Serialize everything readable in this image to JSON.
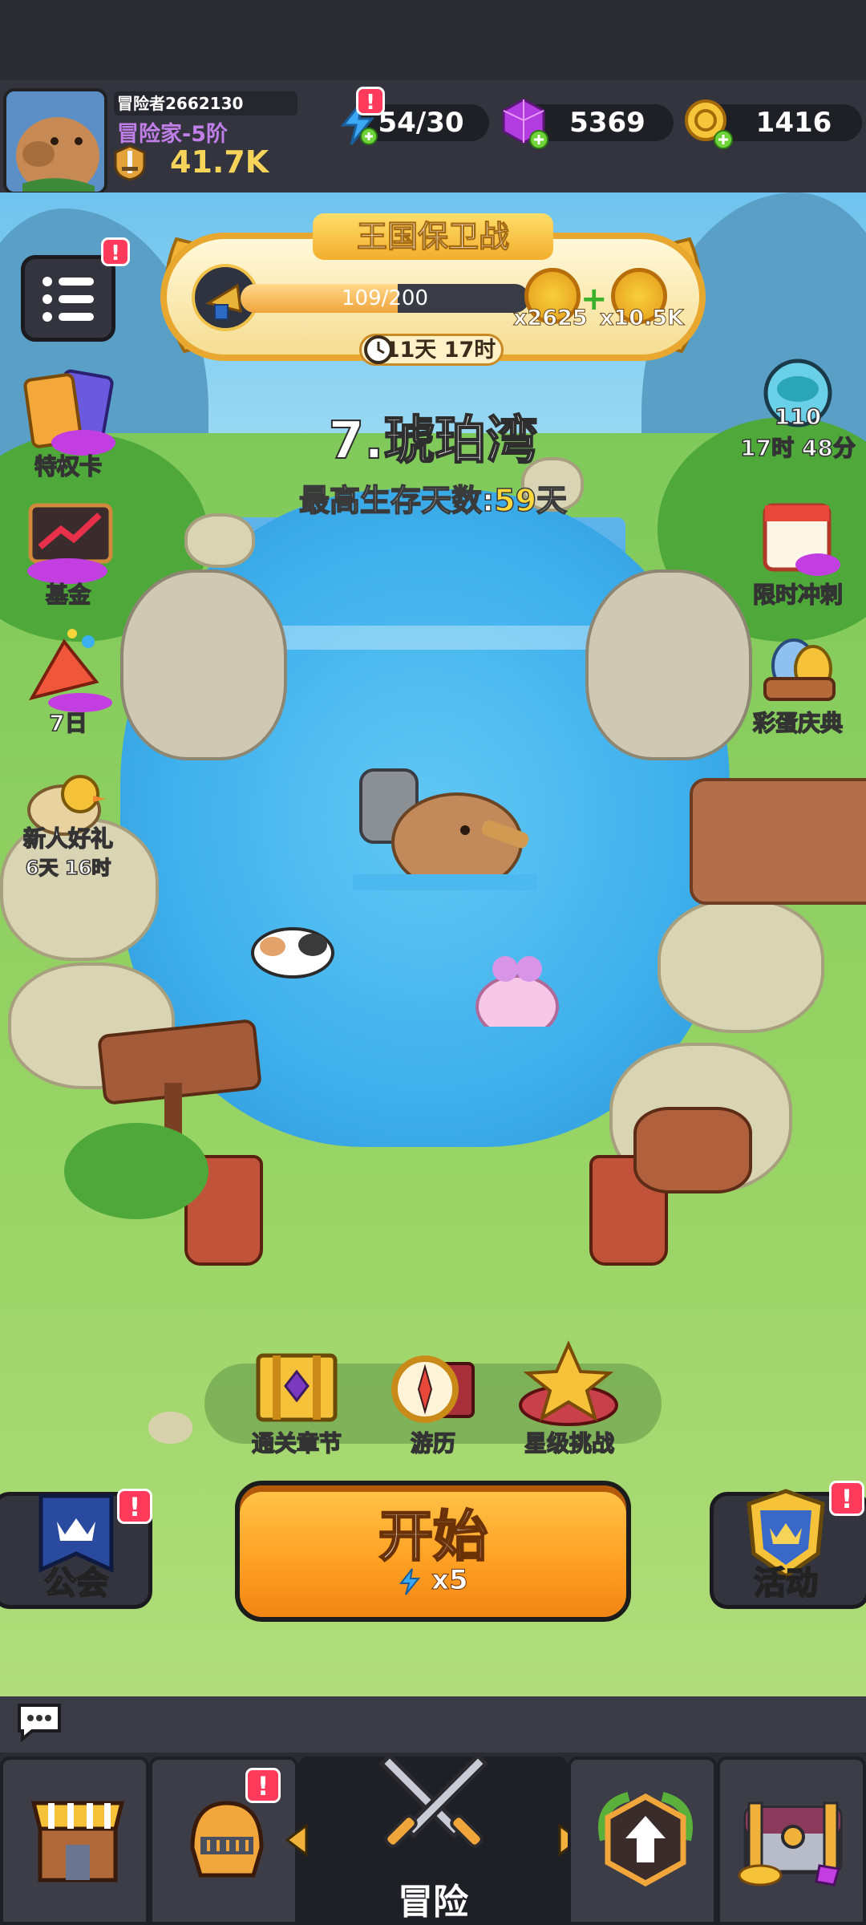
{
  "player": {
    "id_label": "冒险者2662130",
    "rank": "冒险家-5阶",
    "power": "41.7K"
  },
  "resources": {
    "energy": "54/30",
    "gems": "5369",
    "coins": "1416"
  },
  "event": {
    "title": "王国保卫战",
    "progress_text": "109/200",
    "progress": 0.545,
    "reward_1": "x2625",
    "reward_2": "x10.5K",
    "timer": "11天 17时"
  },
  "stage": {
    "name": "7.琥珀湾",
    "best_days_label": "最高生存天数:",
    "best_days_value": "59",
    "best_days_unit": "天"
  },
  "left_menu": {
    "privilege_card": "特权卡",
    "fund": "基金",
    "seven_day": "7日",
    "newbie_gift": "新人好礼",
    "newbie_timer": "6天 16时"
  },
  "right_menu": {
    "level_badge": "110",
    "level_timer": "17时 48分",
    "limited_sprint": "限时冲刺",
    "egg_festival": "彩蛋庆典"
  },
  "tray": {
    "chapters": "通关章节",
    "travel": "游历",
    "star_challenge": "星级挑战"
  },
  "actions": {
    "start": "开始",
    "start_cost": "x5",
    "guild": "公会",
    "activity": "活动"
  },
  "nav": {
    "adventure": "冒险"
  },
  "badges": {
    "alert": "!"
  },
  "colors": {
    "accent_orange": "#ff9f22",
    "alert_red": "#ff3a5a",
    "gold": "#ffd93a"
  }
}
